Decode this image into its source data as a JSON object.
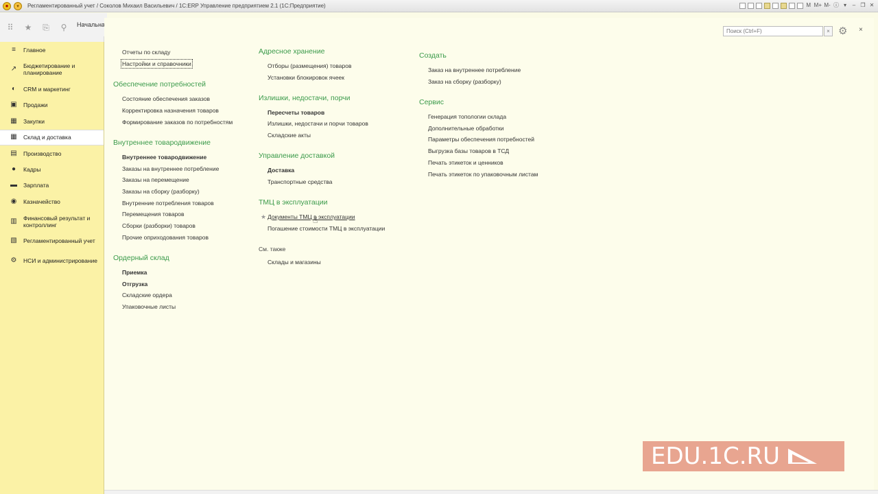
{
  "window": {
    "title": "Регламентированный учет / Соколов Михаил Васильевич / 1С:ERP Управление предприятием 2.1  (1С:Предприятие)",
    "tools": [
      "M",
      "M+",
      "M-"
    ]
  },
  "tabs": {
    "home": "Начальна"
  },
  "search": {
    "placeholder": "Поиск (Ctrl+F)"
  },
  "sidebar": {
    "items": [
      {
        "label": "Главное",
        "icon": "≡"
      },
      {
        "label": "Бюджетирование и планирование",
        "icon": "↗"
      },
      {
        "label": "CRM и маркетинг",
        "icon": "◐"
      },
      {
        "label": "Продажи",
        "icon": "▣"
      },
      {
        "label": "Закупки",
        "icon": "▦"
      },
      {
        "label": "Склад и доставка",
        "icon": "▦"
      },
      {
        "label": "Производство",
        "icon": "▤"
      },
      {
        "label": "Кадры",
        "icon": "●"
      },
      {
        "label": "Зарплата",
        "icon": "▬"
      },
      {
        "label": "Казначейство",
        "icon": "◉"
      },
      {
        "label": "Финансовый результат и контроллинг",
        "icon": "▥"
      },
      {
        "label": "Регламентированный учет",
        "icon": "▧"
      },
      {
        "label": "НСИ и администрирование",
        "icon": "⚙"
      }
    ]
  },
  "col1": {
    "links_top": [
      "Отчеты по складу",
      "Настройки и справочники"
    ],
    "sections": [
      {
        "title": "Обеспечение потребностей",
        "links": [
          "Состояние обеспечения заказов",
          "Корректировка назначения товаров",
          "Формирование заказов по потребностям"
        ]
      },
      {
        "title": "Внутреннее товародвижение",
        "links": [
          "Внутреннее товародвижение",
          "Заказы на внутреннее потребление",
          "Заказы на перемещение",
          "Заказы на сборку (разборку)",
          "Внутренние потребления товаров",
          "Перемещения товаров",
          "Сборки (разборки) товаров",
          "Прочие оприходования товаров"
        ]
      },
      {
        "title": "Ордерный склад",
        "links": [
          "Приемка",
          "Отгрузка",
          "Складские ордера",
          "Упаковочные листы"
        ]
      }
    ]
  },
  "col2": {
    "sections": [
      {
        "title": "Адресное хранение",
        "links": [
          "Отборы (размещения) товаров",
          "Установки блокировок ячеек"
        ]
      },
      {
        "title": "Излишки, недостачи, порчи",
        "links": [
          "Пересчеты товаров",
          "Излишки, недостачи и порчи товаров",
          "Складские акты"
        ]
      },
      {
        "title": "Управление доставкой",
        "links": [
          "Доставка",
          "Транспортные средства"
        ]
      },
      {
        "title": "ТМЦ в эксплуатации",
        "links": [
          "Документы ТМЦ в эксплуатации",
          "Погашение стоимости ТМЦ в эксплуатации"
        ]
      }
    ],
    "see_also": {
      "title": "См. также",
      "links": [
        "Склады и магазины"
      ]
    }
  },
  "col3": {
    "sections": [
      {
        "title": "Создать",
        "links": [
          "Заказ на внутреннее потребление",
          "Заказ на сборку (разборку)"
        ]
      },
      {
        "title": "Сервис",
        "links": [
          "Генерация топологии склада",
          "Дополнительные обработки",
          "Параметры обеспечения потребностей",
          "Выгрузка базы товаров в ТСД",
          "Печать этикеток и ценников",
          "Печать этикеток по упаковочным листам"
        ]
      }
    ]
  },
  "watermark": {
    "text": "EDU.1C.RU"
  },
  "colors": {
    "section": "#3a9a4a",
    "sidebar": "#fbf2a6",
    "panel": "#fdfdeb",
    "watermark": "#e8a590"
  }
}
